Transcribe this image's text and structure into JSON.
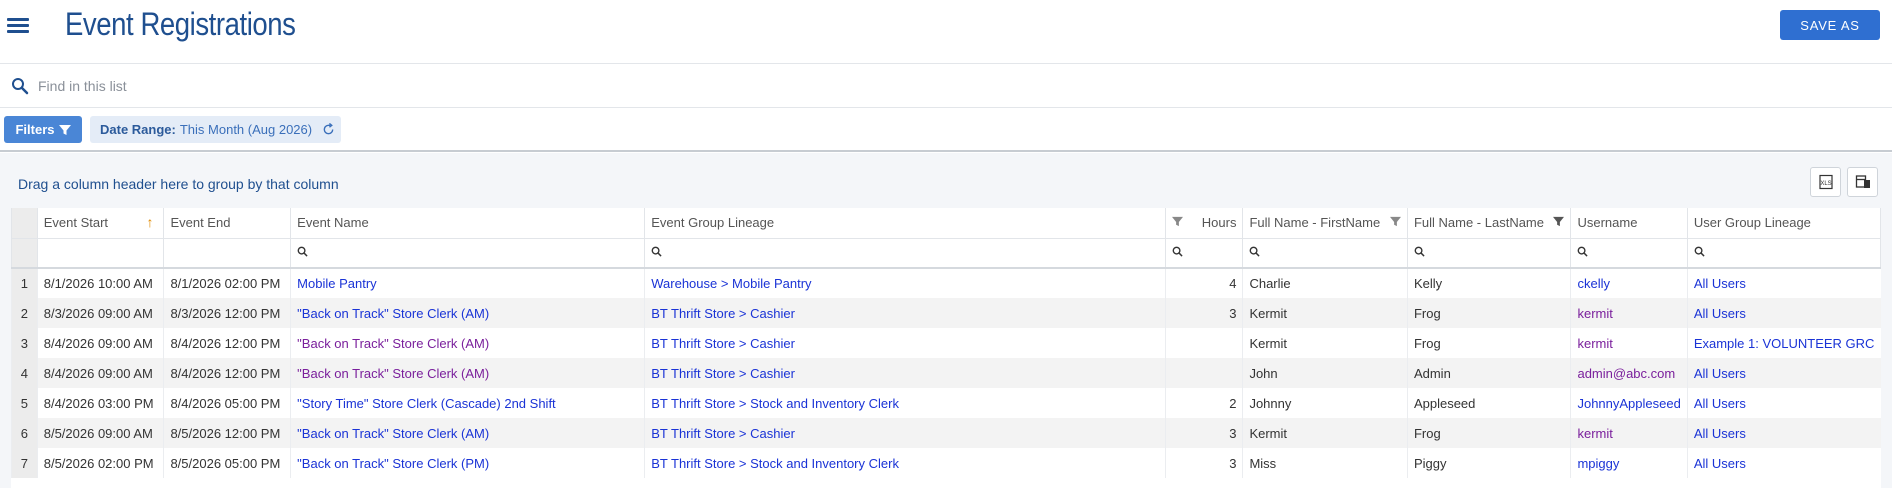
{
  "header": {
    "title": "Event Registrations",
    "save_label": "SAVE AS"
  },
  "search": {
    "placeholder": "Find in this list"
  },
  "filters": {
    "button_label": "Filters",
    "chip_key": "Date Range:",
    "chip_value": "This Month (Aug 2026)"
  },
  "grid": {
    "group_hint": "Drag a column header here to group by that column",
    "columns": [
      "Event Start",
      "Event End",
      "Event Name",
      "Event Group Lineage",
      "Hours",
      "Full Name - FirstName",
      "Full Name - LastName",
      "Username",
      "User Group Lineage"
    ],
    "rows": [
      {
        "num": "1",
        "start": "8/1/2026 10:00 AM",
        "end": "8/1/2026 02:00 PM",
        "event": "Mobile Pantry",
        "lineage": "Warehouse > Mobile Pantry",
        "hours": "4",
        "first": "Charlie",
        "last": "Kelly",
        "user": "ckelly",
        "ugl": "All Users"
      },
      {
        "num": "2",
        "start": "8/3/2026 09:00 AM",
        "end": "8/3/2026 12:00 PM",
        "event": "\"Back on Track\" Store Clerk (AM)",
        "lineage": "BT Thrift Store > Cashier",
        "hours": "3",
        "first": "Kermit",
        "last": "Frog",
        "user": "kermit",
        "ugl": "All Users"
      },
      {
        "num": "3",
        "start": "8/4/2026 09:00 AM",
        "end": "8/4/2026 12:00 PM",
        "event": "\"Back on Track\" Store Clerk (AM)",
        "lineage": "BT Thrift Store > Cashier",
        "hours": "",
        "first": "Kermit",
        "last": "Frog",
        "user": "kermit",
        "ugl": "Example 1: VOLUNTEER GRC"
      },
      {
        "num": "4",
        "start": "8/4/2026 09:00 AM",
        "end": "8/4/2026 12:00 PM",
        "event": "\"Back on Track\" Store Clerk (AM)",
        "lineage": "BT Thrift Store > Cashier",
        "hours": "",
        "first": "John",
        "last": "Admin",
        "user": "admin@abc.com",
        "ugl": "All Users"
      },
      {
        "num": "5",
        "start": "8/4/2026 03:00 PM",
        "end": "8/4/2026 05:00 PM",
        "event": "\"Story Time\" Store Clerk (Cascade) 2nd Shift",
        "lineage": "BT Thrift Store > Stock and Inventory Clerk",
        "hours": "2",
        "first": "Johnny",
        "last": "Appleseed",
        "user": "JohnnyAppleseed",
        "ugl": "All Users"
      },
      {
        "num": "6",
        "start": "8/5/2026 09:00 AM",
        "end": "8/5/2026 12:00 PM",
        "event": "\"Back on Track\" Store Clerk (AM)",
        "lineage": "BT Thrift Store > Cashier",
        "hours": "3",
        "first": "Kermit",
        "last": "Frog",
        "user": "kermit",
        "ugl": "All Users"
      },
      {
        "num": "7",
        "start": "8/5/2026 02:00 PM",
        "end": "8/5/2026 05:00 PM",
        "event": "\"Back on Track\" Store Clerk (PM)",
        "lineage": "BT Thrift Store > Stock and Inventory Clerk",
        "hours": "3",
        "first": "Miss",
        "last": "Piggy",
        "user": "mpiggy",
        "ugl": "All Users"
      }
    ]
  },
  "colors": {
    "accent": "#2f6fd1",
    "title": "#1f4f8f",
    "link": "#1a33d6",
    "visited_link": "#7a1f9c",
    "sort_arrow": "#e08a00"
  }
}
